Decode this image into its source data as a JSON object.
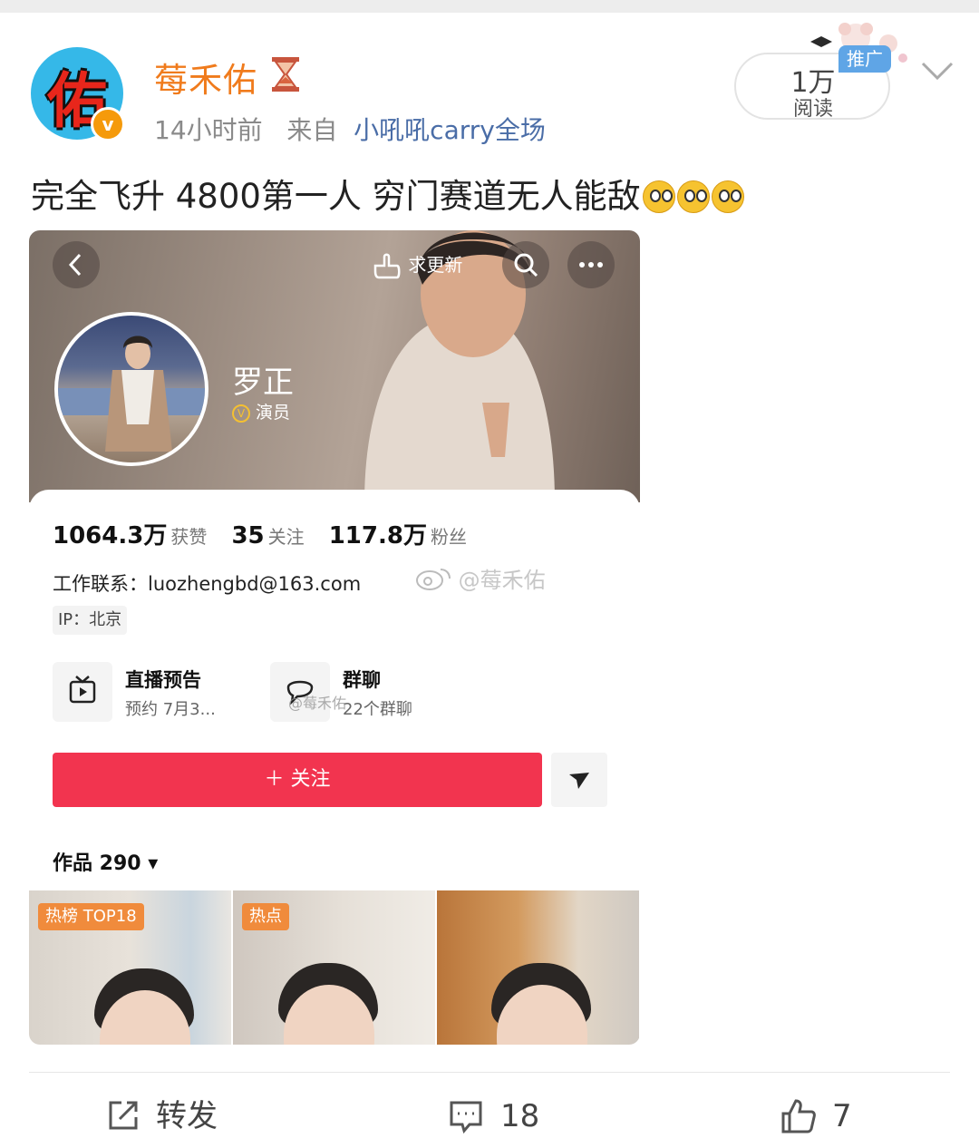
{
  "post": {
    "avatar_char": "佑",
    "verify_badge": "v",
    "username": "莓禾佑",
    "time": "14小时前",
    "source_prefix": "来自",
    "source": "小吼吼carry全场",
    "read_count": "1万",
    "read_label": "阅读",
    "promo": "推广",
    "text": "完全飞升 4800第一人 穷门赛道无人能敌"
  },
  "embedded": {
    "request_update": "求更新",
    "name": "罗正",
    "role": "演员",
    "stats": [
      {
        "num": "1064.3万",
        "label": "获赞"
      },
      {
        "num": "35",
        "label": "关注"
      },
      {
        "num": "117.8万",
        "label": "粉丝"
      }
    ],
    "contact": "工作联系：luozhengbd@163.com",
    "ip": "IP：北京",
    "watermark": "@莓禾佑",
    "live_title": "直播预告",
    "live_sub": "预约 7月3...",
    "group_title": "群聊",
    "group_sub": "22个群聊",
    "group_watermark": "@莓禾佑",
    "follow": "＋ 关注",
    "works": "作品 290 ▾",
    "thumb_tags": [
      "热榜 TOP18",
      "热点"
    ]
  },
  "actions": {
    "repost": "转发",
    "comment": "18",
    "like": "7"
  },
  "colors": {
    "username": "#f07b1c",
    "source_link": "#4a6da7",
    "follow_button": "#f2344f",
    "promo": "#5fa5e6"
  }
}
